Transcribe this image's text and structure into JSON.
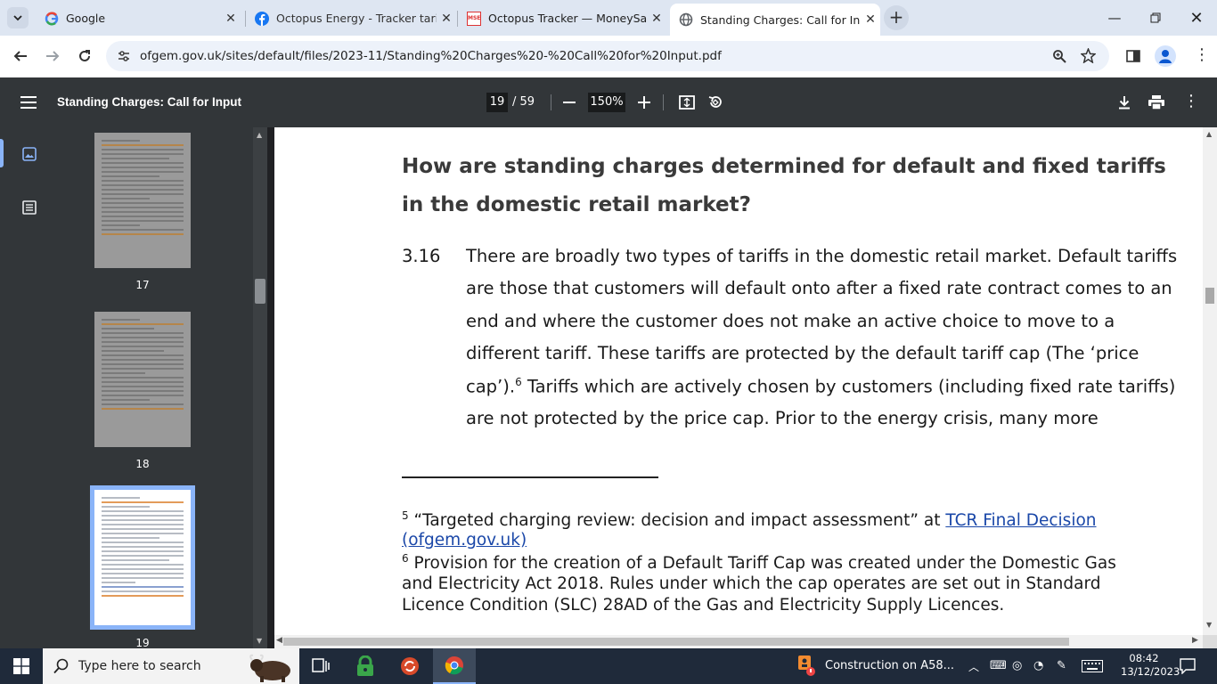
{
  "browser": {
    "tabs": [
      {
        "title": "Google",
        "favicon": "google-icon"
      },
      {
        "title": "Octopus Energy - Tracker tariff",
        "favicon": "facebook-icon"
      },
      {
        "title": "Octopus Tracker — MoneySavin",
        "favicon": "mse-icon"
      },
      {
        "title": "Standing Charges: Call for Input",
        "favicon": "globe-icon",
        "active": true
      }
    ],
    "mse_favicon_text": "MSE",
    "new_tab_label": "+",
    "url": "ofgem.gov.uk/sites/default/files/2023-11/Standing%20Charges%20-%20Call%20for%20Input.pdf"
  },
  "pdf": {
    "title": "Standing Charges: Call for Input",
    "current_page": "19",
    "total_pages": "/ 59",
    "zoom": "150%"
  },
  "thumbnails": [
    {
      "page": "17"
    },
    {
      "page": "18"
    },
    {
      "page": "19",
      "current": true
    }
  ],
  "document": {
    "heading_line1": "How are standing charges determined for default and fixed tariffs",
    "heading_line2": "in the domestic retail market?",
    "para_number": "3.16",
    "para_lines": [
      "There are broadly two types of tariffs in the domestic retail market. Default tariffs",
      "are those that customers will default onto after a fixed rate contract comes to an",
      "end and where the customer does not make an active choice to move to a",
      "different tariff. These tariffs are protected by the default tariff cap (The ‘price",
      "cap’).",
      "Tariffs which are actively chosen by customers (including fixed rate tariffs)",
      "are not protected by the price cap. Prior to the energy crisis, many more"
    ],
    "footnote_ref": "6",
    "footnotes": {
      "fn5_num": "5",
      "fn5_text": "“Targeted charging review: decision and impact assessment” at",
      "fn5_link_a": "TCR Final Decision",
      "fn5_link_b": "(ofgem.gov.uk)",
      "fn6_num": "6",
      "fn6_line1": "Provision for the creation of a Default Tariff Cap was created under the Domestic Gas",
      "fn6_line2": "and Electricity Act 2018. Rules under which the cap operates are set out in Standard",
      "fn6_line3": "Licence Condition (SLC) 28AD of the Gas and Electricity Supply Licences."
    }
  },
  "taskbar": {
    "search_placeholder": "Type here to search",
    "notification": "Construction on A58...",
    "time": "08:42",
    "date": "13/12/2023"
  },
  "colors": {
    "accent": "#8ab4f8",
    "link": "#1a47a8",
    "toolbar": "#323639",
    "taskbar": "#1f2a3a"
  }
}
